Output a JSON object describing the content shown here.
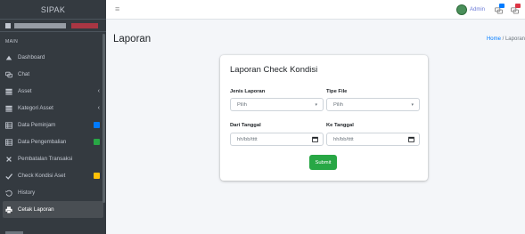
{
  "app": {
    "title": "SIPAK"
  },
  "sidebar": {
    "section_header": "MAIN",
    "items": [
      {
        "label": "Dashboard",
        "icon": "tachometer-icon"
      },
      {
        "label": "Chat",
        "icon": "chat-icon"
      },
      {
        "label": "Asset",
        "icon": "asset-icon"
      },
      {
        "label": "Kategori Asset",
        "icon": "category-icon"
      },
      {
        "label": "Data Peminjam",
        "icon": "list-icon",
        "badge_color": "#007bff"
      },
      {
        "label": "Data Pengembalian",
        "icon": "list-icon",
        "badge_color": "#28a745"
      },
      {
        "label": "Pembatalan Transaksi",
        "icon": "close-icon"
      },
      {
        "label": "Check Kondisi Aset",
        "icon": "check-icon",
        "badge_color": "#ffc107"
      },
      {
        "label": "History",
        "icon": "history-icon"
      },
      {
        "label": "Cetak Laporan",
        "icon": "print-icon",
        "active": true
      }
    ]
  },
  "navbar": {
    "user_label": "Admin",
    "notification_colors": [
      "#007bff",
      "#dc3545"
    ]
  },
  "page": {
    "title": "Laporan",
    "breadcrumb": {
      "home": "Home",
      "separator": "/",
      "current": "Laporan"
    }
  },
  "form": {
    "card_title": "Laporan Check Kondisi",
    "jenis_laporan": {
      "label": "Jenis Laporan",
      "value": "Pilih"
    },
    "tipe_file": {
      "label": "Tipe File",
      "value": "Pilih"
    },
    "dari_tanggal": {
      "label": "Dari Tanggal",
      "placeholder": "hh/bb/tttt"
    },
    "ke_tanggal": {
      "label": "Ke Tanggal",
      "placeholder": "hh/bb/tttt"
    },
    "submit_label": "Submit"
  },
  "colors": {
    "sidebar_bg": "#343a40",
    "accent_green": "#28a745",
    "link_blue": "#007bff"
  }
}
